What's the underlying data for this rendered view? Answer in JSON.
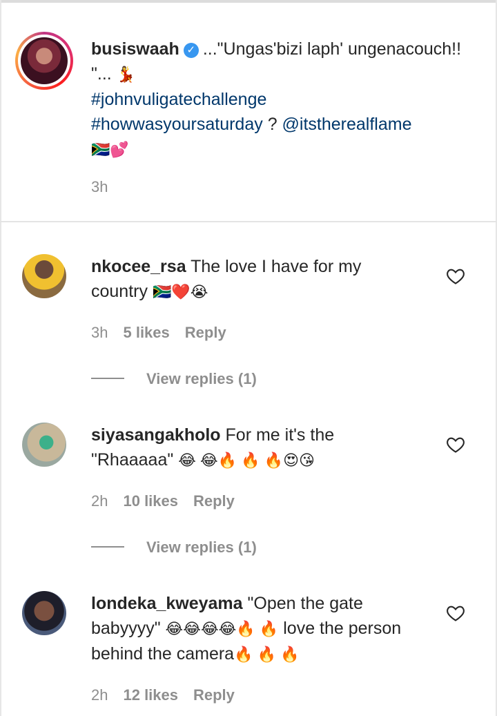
{
  "caption": {
    "username": "busiswaah",
    "verified_icon": "verified-badge-icon",
    "text_part1": "...\"Ungas'bizi laph' ungenacouch!! \"...",
    "emoji_dancer": "💃",
    "hashtag1": "#johnvuligatechallenge",
    "hashtag2": "#howwasyoursaturday",
    "question": " ? ",
    "mention": "@itstherealflame",
    "emoji_flag_hearts": "🇿🇦💕",
    "time": "3h"
  },
  "comments": [
    {
      "username": "nkocee_rsa",
      "text": "The love I have for my country",
      "emoji": "🇿🇦❤️😭",
      "time": "3h",
      "likes": "5 likes",
      "reply": "Reply",
      "view_replies": "View replies (1)"
    },
    {
      "username": "siyasangakholo",
      "text": "For me it's the \"Rhaaaaa\"",
      "emoji": "😂 😂🔥 🔥 🔥😍😘",
      "time": "2h",
      "likes": "10 likes",
      "reply": "Reply",
      "view_replies": "View replies (1)"
    },
    {
      "username": "londeka_kweyama",
      "text_part1": "\"Open the gate babyyyy\"",
      "emoji1": "😂😂😂😂🔥 🔥",
      "text_part2": "love the person behind the camera",
      "emoji2": "🔥 🔥 🔥",
      "time": "2h",
      "likes": "12 likes",
      "reply": "Reply"
    }
  ],
  "colors": {
    "text": "#262626",
    "secondary": "#8e8e8e",
    "link": "#00376b",
    "verified": "#3897f0"
  }
}
